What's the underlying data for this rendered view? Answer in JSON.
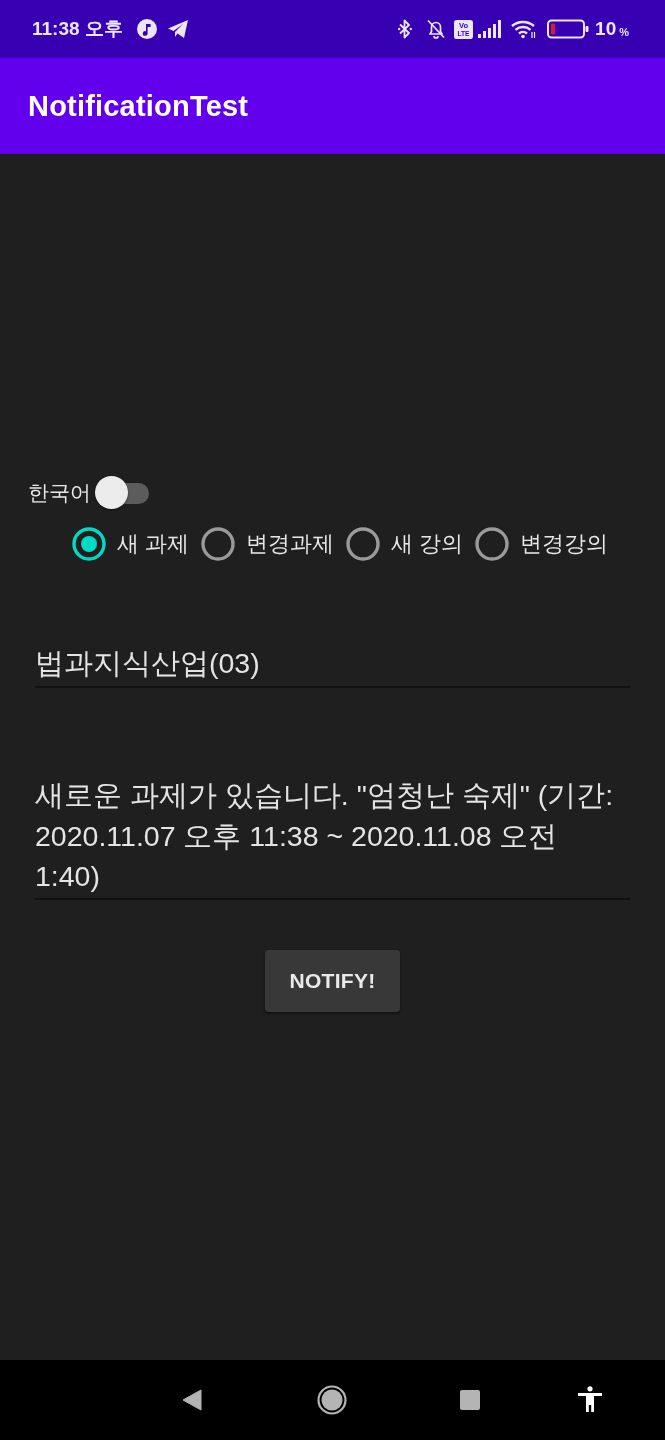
{
  "status_bar": {
    "time": "11:38 오후",
    "volte_label": [
      "Vo",
      "LTE"
    ],
    "battery_text": "10",
    "battery_unit": "%"
  },
  "app_bar": {
    "title": "NotificationTest"
  },
  "language_switch": {
    "label": "한국어",
    "on": false
  },
  "radios": [
    {
      "label": "새 과제",
      "selected": true
    },
    {
      "label": "변경과제",
      "selected": false
    },
    {
      "label": "새 강의",
      "selected": false
    },
    {
      "label": "변경강의",
      "selected": false
    }
  ],
  "course_field": {
    "value": "법과지식산업(03)"
  },
  "message_field": {
    "value": "새로운 과제가 있습니다. \"엄청난 숙제\" (기간: 2020.11.07 오후 11:38 ~ 2020.11.08 오전 1:40)"
  },
  "notify_button": {
    "label": "NOTIFY!"
  }
}
